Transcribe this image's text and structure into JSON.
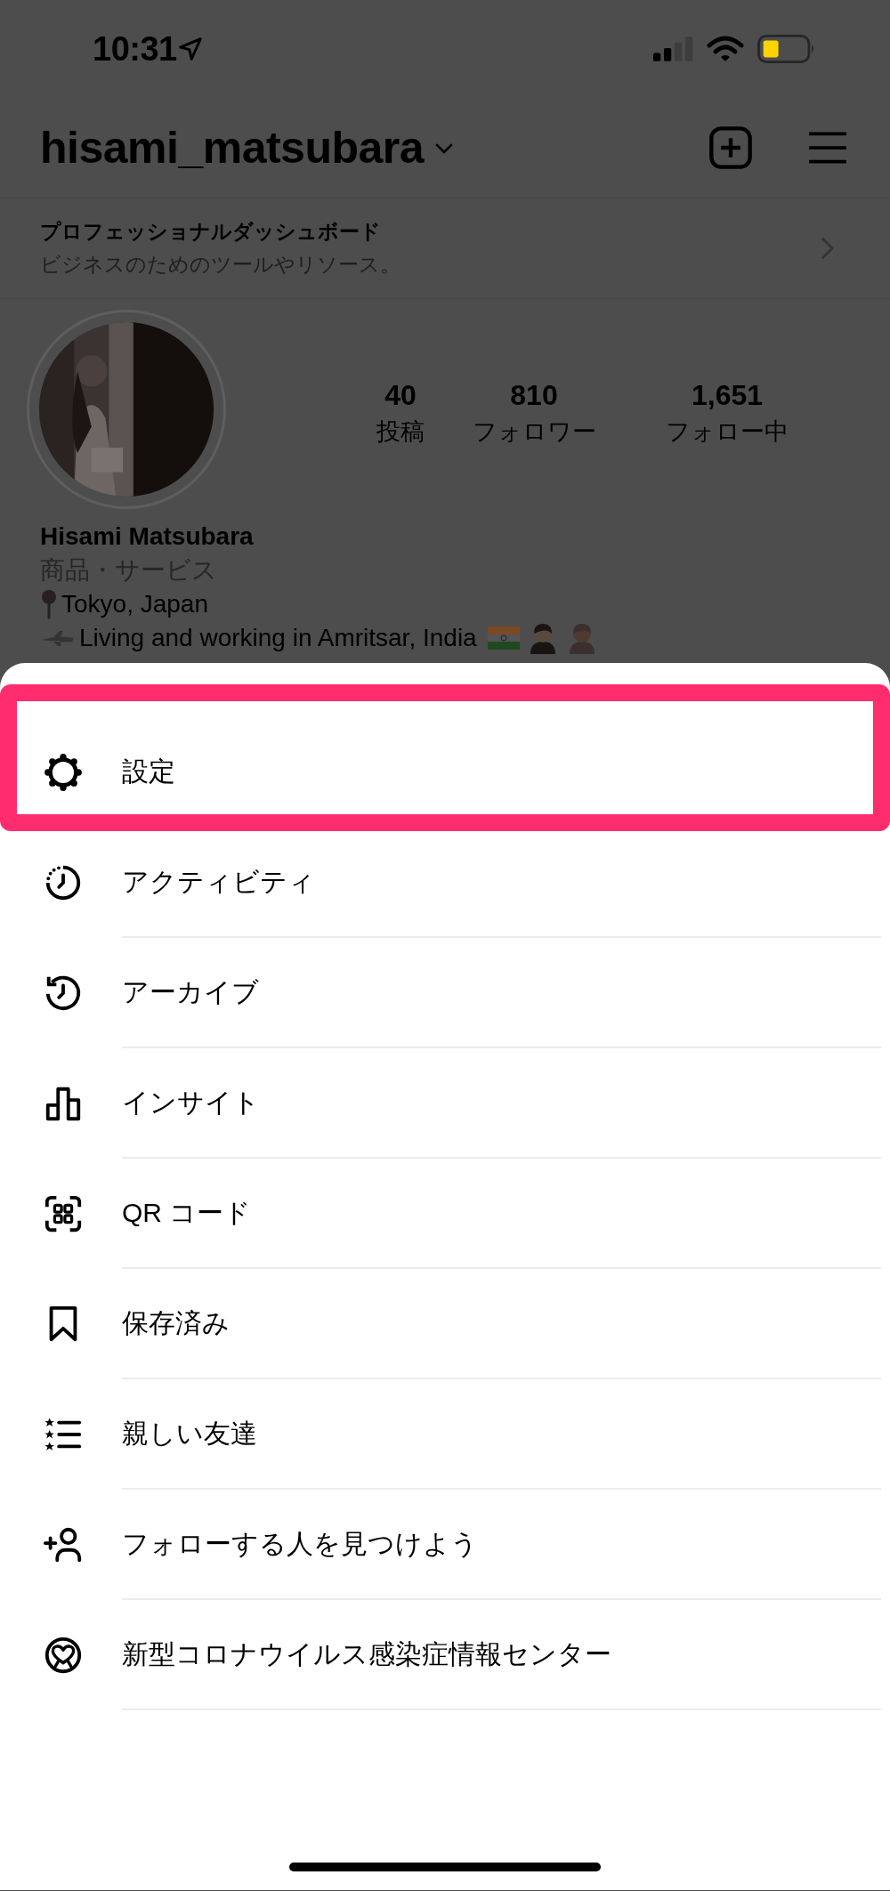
{
  "status_bar": {
    "time": "10:31"
  },
  "header": {
    "username": "hisami_matsubara"
  },
  "dashboard": {
    "title": "プロフェッショナルダッシュボード",
    "subtitle": "ビジネスのためのツールやリソース。"
  },
  "profile": {
    "stats": [
      {
        "value": "40",
        "label": "投稿"
      },
      {
        "value": "810",
        "label": "フォロワー"
      },
      {
        "value": "1,651",
        "label": "フォロー中"
      }
    ],
    "name": "Hisami Matsubara",
    "category": "商品・サービス",
    "bio": [
      {
        "kind": "location",
        "text": "Tokyo, Japan"
      },
      {
        "kind": "travel",
        "text": "Living and working in Amritsar, India"
      }
    ]
  },
  "menu": {
    "items": [
      {
        "kind": "settings",
        "label": "設定",
        "highlighted": true
      },
      {
        "kind": "activity",
        "label": "アクティビティ",
        "highlighted": false
      },
      {
        "kind": "archive",
        "label": "アーカイブ",
        "highlighted": false
      },
      {
        "kind": "insights",
        "label": "インサイト",
        "highlighted": false
      },
      {
        "kind": "qr",
        "label": "QR コード",
        "highlighted": false
      },
      {
        "kind": "saved",
        "label": "保存済み",
        "highlighted": false
      },
      {
        "kind": "close_friends",
        "label": "親しい友達",
        "highlighted": false
      },
      {
        "kind": "discover",
        "label": "フォローする人を見つけよう",
        "highlighted": false
      },
      {
        "kind": "covid",
        "label": "新型コロナウイルス感染症情報センター",
        "highlighted": false
      }
    ]
  }
}
